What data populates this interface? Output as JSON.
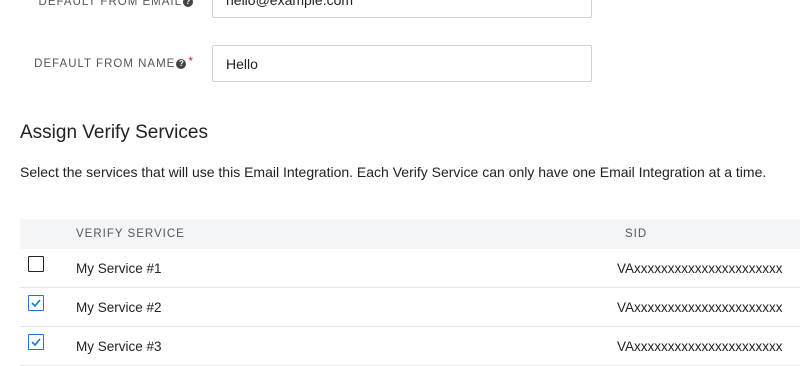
{
  "form": {
    "from_email": {
      "label": "DEFAULT FROM EMAIL",
      "value": "hello@example.com",
      "required": false
    },
    "from_name": {
      "label": "DEFAULT FROM NAME",
      "value": "Hello",
      "required": true,
      "required_mark": "*"
    },
    "help_glyph": "?"
  },
  "services_section": {
    "title": "Assign Verify Services",
    "description": "Select the services that will use this Email Integration. Each Verify Service can only have one Email Integration at a time."
  },
  "table": {
    "columns": [
      "VERIFY SERVICE",
      "SID"
    ],
    "rows": [
      {
        "name": "My Service #1",
        "sid": "VAxxxxxxxxxxxxxxxxxxxxxx",
        "checked": false
      },
      {
        "name": "My Service #2",
        "sid": "VAxxxxxxxxxxxxxxxxxxxxxx",
        "checked": true
      },
      {
        "name": "My Service #3",
        "sid": "VAxxxxxxxxxxxxxxxxxxxxxx",
        "checked": true
      }
    ]
  },
  "colors": {
    "checkbox_checked": "#1b74d6",
    "required_mark": "#e0283b",
    "table_header_bg": "#f4f5f6"
  },
  "icons": {
    "help": "help-circle-icon",
    "check": "check-icon"
  }
}
